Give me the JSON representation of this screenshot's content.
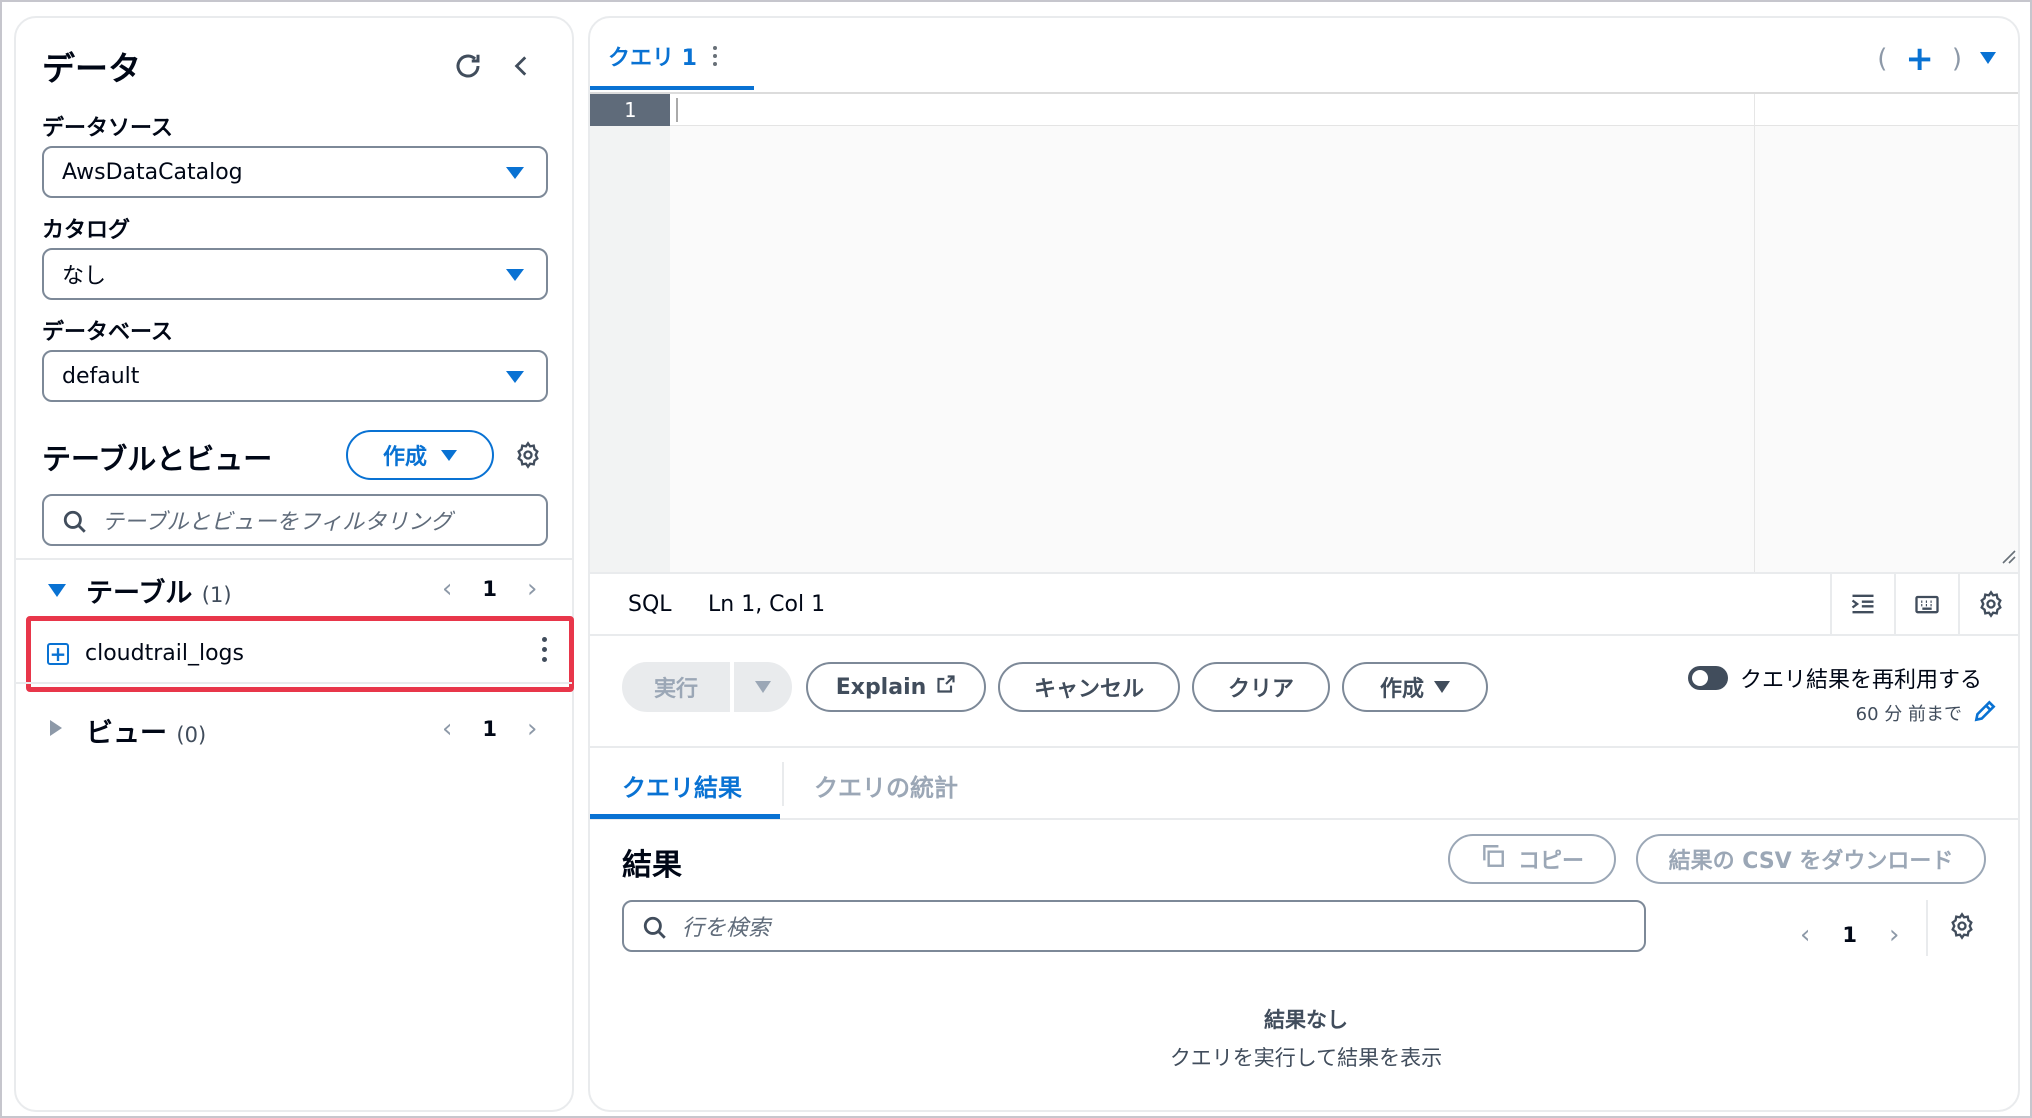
{
  "left_panel": {
    "title": "データ",
    "data_source": {
      "label": "データソース",
      "value": "AwsDataCatalog"
    },
    "catalog": {
      "label": "カタログ",
      "value": "なし"
    },
    "database": {
      "label": "データベース",
      "value": "default"
    },
    "tables_views": {
      "title": "テーブルとビュー",
      "create_label": "作成",
      "filter_placeholder": "テーブルとビューをフィルタリング"
    },
    "tables_section": {
      "label": "テーブル",
      "count": "(1)",
      "page": "1"
    },
    "table_items": [
      {
        "name": "cloudtrail_logs"
      }
    ],
    "views_section": {
      "label": "ビュー",
      "count": "(0)",
      "page": "1"
    }
  },
  "editor": {
    "tab_label": "クエリ 1",
    "add_tab_left": "(",
    "add_tab_plus": "+",
    "add_tab_right": ")",
    "line_number": "1",
    "language": "SQL",
    "cursor_pos": "Ln 1, Col 1"
  },
  "actions": {
    "run": "実行",
    "explain": "Explain",
    "cancel": "キャンセル",
    "clear": "クリア",
    "create": "作成",
    "reuse_label": "クエリ結果を再利用する",
    "reuse_sub": "60 分 前まで"
  },
  "results": {
    "tab_results": "クエリ結果",
    "tab_stats": "クエリの統計",
    "title": "結果",
    "copy": "コピー",
    "download": "結果の CSV をダウンロード",
    "search_placeholder": "行を検索",
    "page": "1",
    "empty_title": "結果なし",
    "empty_sub": "クエリを実行して結果を表示"
  },
  "colors": {
    "accent": "#0972d3",
    "highlight": "#e8364a"
  }
}
